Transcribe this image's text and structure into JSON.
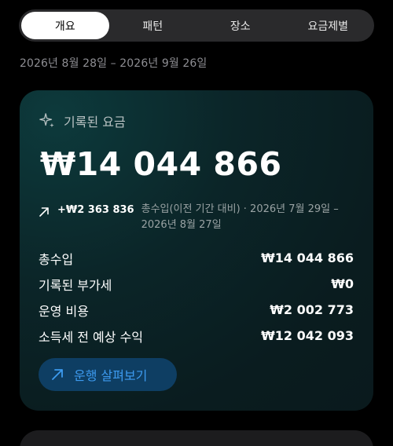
{
  "tabs": [
    {
      "label": "개요",
      "active": true
    },
    {
      "label": "패턴",
      "active": false
    },
    {
      "label": "장소",
      "active": false
    },
    {
      "label": "요금제별",
      "active": false
    }
  ],
  "date_range": "2026년 8월 28일 – 2026년 9월 26일",
  "card": {
    "icon": "sparkle-icon",
    "title": "기록된 요금",
    "amount": "₩14 044 866",
    "delta": {
      "icon": "arrow-up-right-icon",
      "value": "+₩2 363 836",
      "description": "총수입(이전 기간 대비) · 2026년 7월 29일 – 2026년 8월 27일"
    },
    "rows": [
      {
        "label": "총수입",
        "value": "₩14 044 866"
      },
      {
        "label": "기록된 부가세",
        "value": "₩0"
      },
      {
        "label": "운영 비용",
        "value": "₩2 002 773"
      },
      {
        "label": "소득세 전 예상 수익",
        "value": "₩12 042 093"
      }
    ],
    "button": {
      "label": "운행 살펴보기",
      "icon": "arrow-up-right-icon"
    }
  },
  "colors": {
    "background": "#000000",
    "tab_track": "#2a2a2c",
    "card_bg": "#0b2528",
    "accent_blue": "#3d9bf0",
    "button_bg": "#0e3e63",
    "muted_text": "#8e8e93"
  }
}
